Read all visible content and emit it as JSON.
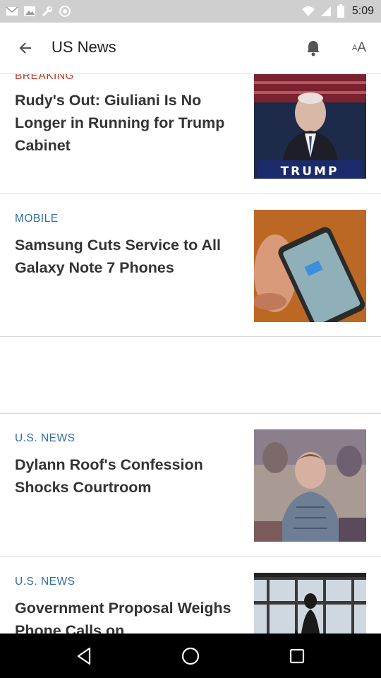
{
  "status_bar": {
    "time": "5:09",
    "icons": [
      "mail-icon",
      "photo-icon",
      "wrench-icon",
      "target-icon",
      "wifi-icon",
      "signal-icon",
      "battery-icon"
    ]
  },
  "app_bar": {
    "title": "US News",
    "back_icon": "arrow-back-icon",
    "notification_icon": "bell-icon",
    "font_size_small": "A",
    "font_size_big": "A"
  },
  "articles": [
    {
      "kicker": "BREAKING",
      "kicker_color": "#c0392b",
      "headline": "Rudy's Out: Giuliani Is No Longer in Running for Trump Cabinet",
      "thumb_text": "TRUMP"
    },
    {
      "kicker": "MOBILE",
      "kicker_color": "#2e6da4",
      "headline": "Samsung Cuts Service to All Galaxy Note 7 Phones"
    },
    {
      "kicker": "U.S. NEWS",
      "kicker_color": "#2e6da4",
      "headline": "Dylann Roof's Confession Shocks Courtroom"
    },
    {
      "kicker": "U.S. NEWS",
      "kicker_color": "#2e6da4",
      "headline": "Government Proposal Weighs Phone Calls on"
    }
  ],
  "nav_bar": {
    "icons": [
      "back-triangle-icon",
      "home-circle-icon",
      "recents-square-icon"
    ]
  }
}
